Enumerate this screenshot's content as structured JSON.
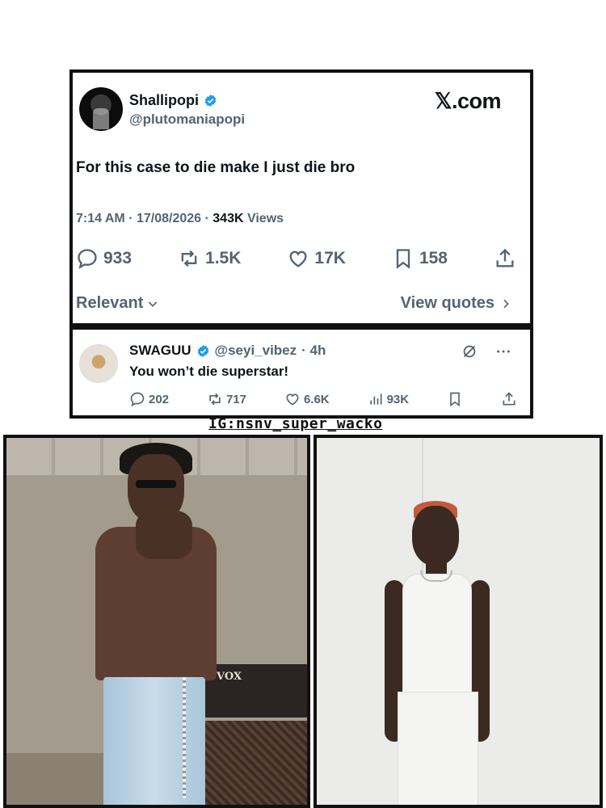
{
  "tweet": {
    "display_name": "Shallipopi",
    "handle": "@plutomaniapopi",
    "brand": "𝕏.com",
    "text": "For this case to die make I just die bro",
    "time_date": "7:14 AM · 17/08/2026 · ",
    "views_count": "343K",
    "views_label": " Views",
    "stats": {
      "replies": "933",
      "reposts": "1.5K",
      "likes": "17K",
      "bookmarks": "158"
    },
    "sort_label": "Relevant",
    "view_quotes_label": "View quotes"
  },
  "reply": {
    "display_name": "SWAGUU",
    "handle": "@seyi_vibez",
    "time": "· 4h",
    "text": "You won’t die superstar!",
    "stats": {
      "replies": "202",
      "reposts": "717",
      "likes": "6.6K",
      "views": "93K"
    }
  },
  "watermark": "IG:nsnv_super_wacko",
  "photos": {
    "left_amp_label": "VOX"
  },
  "colors": {
    "verified_blue": "#1d9bf0",
    "muted_text": "#536471",
    "border": "#111111"
  },
  "icons": [
    "verified-badge-icon",
    "reply-icon",
    "repost-icon",
    "like-icon",
    "bookmark-icon",
    "share-icon",
    "chevron-down-icon",
    "chevron-right-icon",
    "grok-icon",
    "more-icon",
    "views-icon"
  ]
}
